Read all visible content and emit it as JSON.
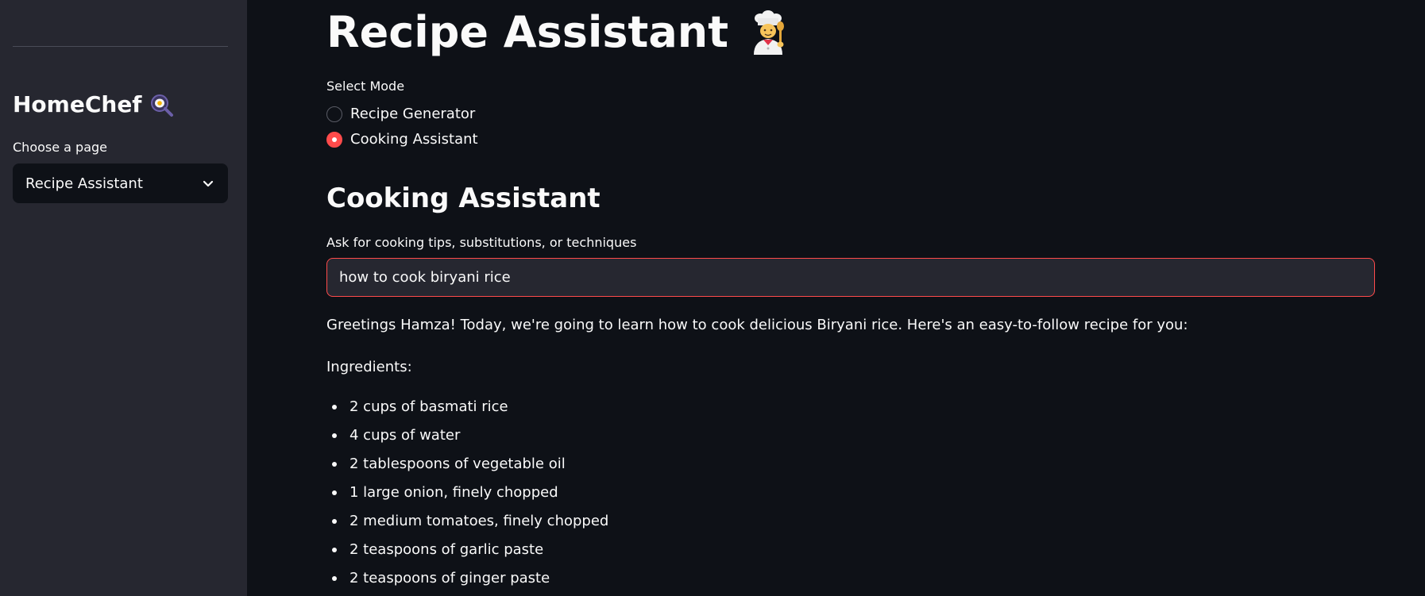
{
  "sidebar": {
    "brand": "HomeChef",
    "brand_icon": "magnifier-egg-icon",
    "page_label": "Choose a page",
    "selected_page": "Recipe Assistant"
  },
  "main": {
    "title": "Recipe Assistant",
    "title_icon": "chef-icon",
    "mode_label": "Select Mode",
    "modes": [
      {
        "label": "Recipe Generator",
        "checked": false
      },
      {
        "label": "Cooking Assistant",
        "checked": true
      }
    ],
    "section_title": "Cooking Assistant",
    "input": {
      "label": "Ask for cooking tips, substitutions, or techniques",
      "value": "how to cook biryani rice"
    },
    "response": {
      "intro": "Greetings Hamza! Today, we're going to learn how to cook delicious Biryani rice. Here's an easy-to-follow recipe for you:",
      "ingredients_heading": "Ingredients:",
      "ingredients": [
        "2 cups of basmati rice",
        "4 cups of water",
        "2 tablespoons of vegetable oil",
        "1 large onion, finely chopped",
        "2 medium tomatoes, finely chopped",
        "2 teaspoons of garlic paste",
        "2 teaspoons of ginger paste"
      ]
    }
  },
  "colors": {
    "accent": "#ff4b4b",
    "background": "#0e1117",
    "sidebar": "#262730",
    "text": "#fafafa"
  }
}
